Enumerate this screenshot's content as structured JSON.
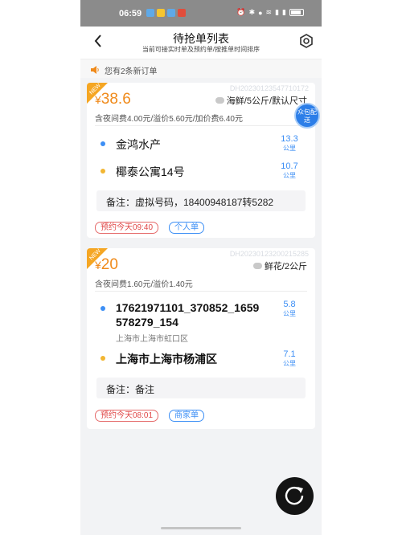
{
  "status_bar": {
    "time": "06:59"
  },
  "header": {
    "title": "待抢单列表",
    "subtitle": "当前可接实时单及预约单/按推单时间排序"
  },
  "notice": {
    "text": "您有2条新订单"
  },
  "orders": [
    {
      "order_no": "DH20230123547710172",
      "price_symbol": "¥",
      "price": "38.6",
      "goods": "海鲜/5公斤/默认尺寸",
      "fees": "含夜间费4.00元/溢价5.60元/加价费6.40元",
      "zhongbao": "众包配送",
      "pickup": {
        "name": "金鸿水产",
        "distance": "13.3",
        "unit": "公里"
      },
      "dropoff": {
        "name": "椰泰公寓14号",
        "distance": "10.7",
        "unit": "公里"
      },
      "remark": "备注：虚拟号码，18400948187转5282",
      "tag_time": "预约今天09:40",
      "tag_type": "个人单"
    },
    {
      "order_no": "DH20230123200215285",
      "price_symbol": "¥",
      "price": "20",
      "goods": "鲜花/2公斤",
      "fees": "含夜间费1.60元/溢价1.40元",
      "pickup": {
        "name_line1": "17621971101_370852_1659",
        "name_line2": "578279_154",
        "sub": "上海市上海市虹口区",
        "distance": "5.8",
        "unit": "公里"
      },
      "dropoff": {
        "name": "上海市上海市杨浦区",
        "distance": "7.1",
        "unit": "公里"
      },
      "remark": "备注：备注",
      "tag_time": "预约今天08:01",
      "tag_type": "商家单"
    }
  ],
  "colors": {
    "accent": "#3d8ff5",
    "price": "#f08a1a",
    "status_bar": "#8b8b8b"
  }
}
